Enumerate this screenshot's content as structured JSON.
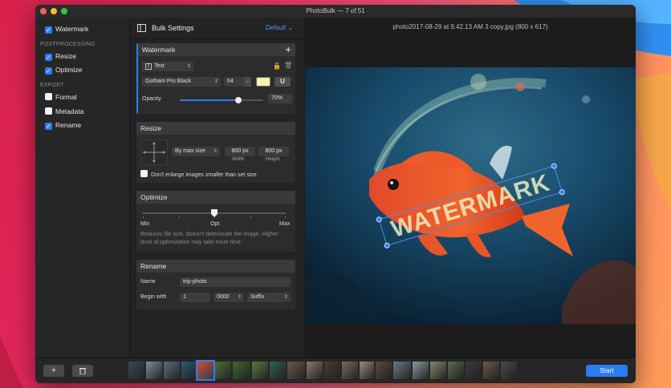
{
  "window": {
    "title": "PhotoBulk — 7 of 51"
  },
  "sidebar": {
    "items_top": [
      {
        "label": "Watermark",
        "checked": true
      }
    ],
    "postprocessing_label": "POSTPROCESSING",
    "postprocessing": [
      {
        "label": "Resize",
        "checked": true
      },
      {
        "label": "Optimize",
        "checked": true
      }
    ],
    "export_label": "EXPORT",
    "export": [
      {
        "label": "Format",
        "checked": false
      },
      {
        "label": "Metadata",
        "checked": false
      },
      {
        "label": "Rename",
        "checked": true
      }
    ]
  },
  "settings": {
    "title": "Bulk Settings",
    "preset": "Default",
    "watermark": {
      "title": "Watermark",
      "type": "Text",
      "font": "Gotham Pro Black",
      "size": "64",
      "opacity_label": "Opacity",
      "opacity_value": "70%",
      "opacity_fraction": 0.7,
      "color": "#f2f5a9"
    },
    "resize": {
      "title": "Resize",
      "mode": "By max size",
      "width": "800 px",
      "height": "800 px",
      "width_label": "Width",
      "height_label": "Height",
      "dont_enlarge": "Don't enlarge images smaller than set size"
    },
    "optimize": {
      "title": "Optimize",
      "min": "Min",
      "opt": "Opt",
      "max": "Max",
      "level_fraction": 0.5,
      "description": "Reduces file size, doesn't deteriorate the image. Higher level of optimization may take more time."
    },
    "rename": {
      "title": "Rename",
      "name_label": "Name",
      "name_value": "trip-photo",
      "begin_label": "Begin with",
      "begin_value": "1",
      "digits": "0000",
      "position": "Suffix"
    }
  },
  "preview": {
    "filename": "photo2017-08-29 at 9.42.13 AM 3 copy.jpg (800 x 617)",
    "watermark_text": "WATERMARK"
  },
  "footer": {
    "start": "Start",
    "add_icon": "plus-icon",
    "delete_icon": "trash-icon"
  },
  "colors": {
    "accent": "#2d7cf6",
    "start": "#2b7bf1"
  }
}
